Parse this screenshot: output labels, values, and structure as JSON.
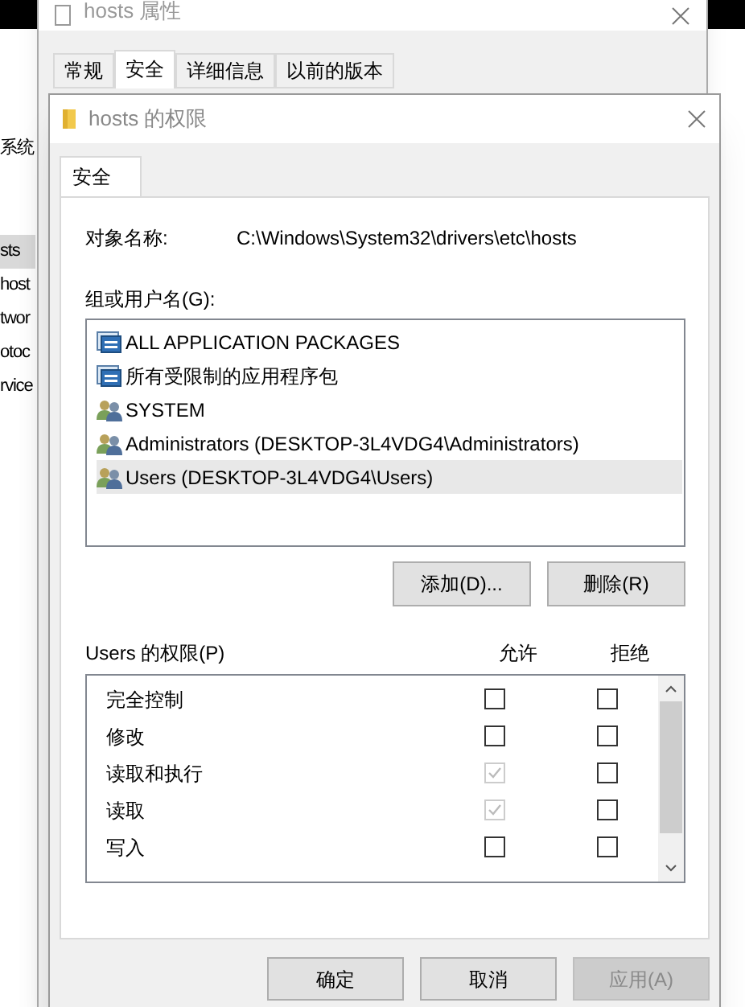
{
  "background": {
    "items": [
      {
        "label": "系统",
        "selected": false
      },
      {
        "label": "sts",
        "selected": true
      },
      {
        "label": "host",
        "selected": false
      },
      {
        "label": "twor",
        "selected": false
      },
      {
        "label": "otoc",
        "selected": false
      },
      {
        "label": "rvice",
        "selected": false
      }
    ]
  },
  "properties_window": {
    "title": "hosts 属性",
    "tabs": [
      {
        "label": "常规",
        "selected": false
      },
      {
        "label": "安全",
        "selected": true
      },
      {
        "label": "详细信息",
        "selected": false
      },
      {
        "label": "以前的版本",
        "selected": false
      }
    ]
  },
  "permissions_dialog": {
    "title": "hosts 的权限",
    "tabs": [
      {
        "label": "安全",
        "selected": true
      }
    ],
    "object_name_label": "对象名称:",
    "object_name": "C:\\Windows\\System32\\drivers\\etc\\hosts",
    "groups_label": "组或用户名(G):",
    "principals": [
      {
        "name": "ALL APPLICATION PACKAGES",
        "kind": "package",
        "selected": false
      },
      {
        "name": "所有受限制的应用程序包",
        "kind": "package",
        "selected": false
      },
      {
        "name": "SYSTEM",
        "kind": "group",
        "selected": false
      },
      {
        "name": "Administrators (DESKTOP-3L4VDG4\\Administrators)",
        "kind": "group",
        "selected": false
      },
      {
        "name": "Users (DESKTOP-3L4VDG4\\Users)",
        "kind": "group",
        "selected": true
      }
    ],
    "list_buttons": [
      "添加(D)...",
      "删除(R)"
    ],
    "permissions_label": "Users 的权限(P)",
    "allow_header": "允许",
    "deny_header": "拒绝",
    "permissions": [
      {
        "name": "完全控制",
        "allow": {
          "checked": false,
          "disabled": false
        },
        "deny": {
          "checked": false,
          "disabled": false
        }
      },
      {
        "name": "修改",
        "allow": {
          "checked": false,
          "disabled": false
        },
        "deny": {
          "checked": false,
          "disabled": false
        }
      },
      {
        "name": "读取和执行",
        "allow": {
          "checked": true,
          "disabled": true
        },
        "deny": {
          "checked": false,
          "disabled": false
        }
      },
      {
        "name": "读取",
        "allow": {
          "checked": true,
          "disabled": true
        },
        "deny": {
          "checked": false,
          "disabled": false
        }
      },
      {
        "name": "写入",
        "allow": {
          "checked": false,
          "disabled": false
        },
        "deny": {
          "checked": false,
          "disabled": false
        }
      }
    ],
    "footer_buttons": [
      {
        "label": "确定",
        "disabled": false
      },
      {
        "label": "取消",
        "disabled": false
      },
      {
        "label": "应用(A)",
        "disabled": true
      }
    ]
  }
}
